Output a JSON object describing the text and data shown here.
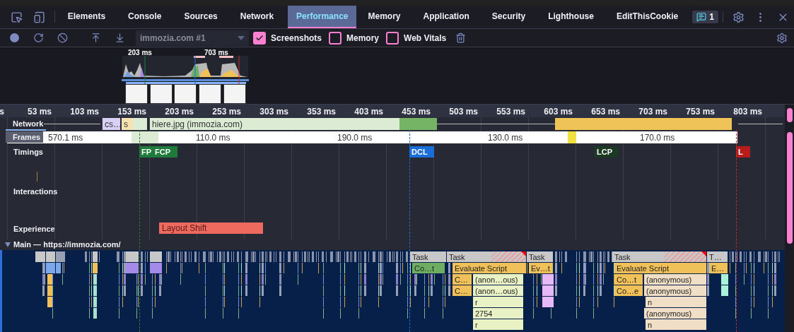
{
  "tabs": [
    {
      "label": "Elements",
      "selected": false
    },
    {
      "label": "Console",
      "selected": false
    },
    {
      "label": "Sources",
      "selected": false
    },
    {
      "label": "Network",
      "selected": false
    },
    {
      "label": "Performance",
      "selected": true
    },
    {
      "label": "Memory",
      "selected": false
    },
    {
      "label": "Application",
      "selected": false
    },
    {
      "label": "Security",
      "selected": false
    },
    {
      "label": "Lighthouse",
      "selected": false
    },
    {
      "label": "EditThisCookie",
      "selected": false
    }
  ],
  "issues_badge": "1",
  "toolbar": {
    "profile": "immozia.com #1",
    "options": [
      {
        "label": "Screenshots",
        "checked": true
      },
      {
        "label": "Memory",
        "checked": false
      },
      {
        "label": "Web Vitals",
        "checked": false
      }
    ]
  },
  "overview": {
    "markers": [
      "203 ms",
      "703 ms"
    ]
  },
  "ruler": [
    "s",
    "53 ms",
    "103 ms",
    "153 ms",
    "203 ms",
    "253 ms",
    "303 ms",
    "353 ms",
    "403 ms",
    "453 ms",
    "503 ms",
    "553 ms",
    "603 ms",
    "653 ms",
    "703 ms",
    "753 ms",
    "803 ms"
  ],
  "network": {
    "label": "Network",
    "requests": [
      "cs…",
      "s",
      "hiere.jpg (immozia.com)"
    ]
  },
  "frames": {
    "label": "Frames",
    "durations": [
      "570.1 ms",
      "110.0 ms",
      "190.0 ms",
      "130.0 ms",
      "170.0 ms"
    ]
  },
  "timings": {
    "label": "Timings",
    "marks": [
      {
        "label": "FP",
        "color": "#1e7b3a"
      },
      {
        "label": "FCP",
        "color": "#1e7b3a"
      },
      {
        "label": "DCL",
        "color": "#1a6ed8"
      },
      {
        "label": "LCP",
        "color": "#1b3a22"
      },
      {
        "label": "L",
        "color": "#b71c1c"
      }
    ]
  },
  "interactions": {
    "label": "Interactions"
  },
  "experience": {
    "label": "Experience",
    "events": [
      "Layout Shift"
    ]
  },
  "main": {
    "title": "Main — https://immozia.com/",
    "blocks": [
      {
        "text": "Task",
        "kind": "task",
        "long_task": false
      },
      {
        "text": "Task",
        "kind": "task",
        "long_task": true
      },
      {
        "text": "Task",
        "kind": "task",
        "long_task": false
      },
      {
        "text": "Task",
        "kind": "task",
        "long_task": true
      },
      {
        "text": "T…",
        "kind": "task",
        "long_task": false
      },
      {
        "text": "Co…t",
        "kind": "compile",
        "long_task": false
      },
      {
        "text": "Evaluate Script",
        "kind": "script",
        "long_task": false
      },
      {
        "text": "Ev…t",
        "kind": "script",
        "long_task": false
      },
      {
        "text": "Evaluate Script",
        "kind": "script",
        "long_task": false
      },
      {
        "text": "E…",
        "kind": "script",
        "long_task": false
      },
      {
        "text": "C…",
        "kind": "script",
        "long_task": false
      },
      {
        "text": "(anon…ous)",
        "kind": "function",
        "long_task": false
      },
      {
        "text": "Co…t",
        "kind": "script",
        "long_task": false
      },
      {
        "text": "(anonymous)",
        "kind": "call",
        "long_task": false
      },
      {
        "text": "C…",
        "kind": "script",
        "long_task": false
      },
      {
        "text": "(anon…ous)",
        "kind": "function",
        "long_task": false
      },
      {
        "text": "Co…e",
        "kind": "script",
        "long_task": false
      },
      {
        "text": "(anonymous)",
        "kind": "call",
        "long_task": false
      },
      {
        "text": "r",
        "kind": "function",
        "long_task": false
      },
      {
        "text": "n",
        "kind": "call",
        "long_task": false
      },
      {
        "text": "2754",
        "kind": "function",
        "long_task": false
      },
      {
        "text": "(anonymous)",
        "kind": "call",
        "long_task": false
      },
      {
        "text": "r",
        "kind": "function",
        "long_task": false
      },
      {
        "text": "n",
        "kind": "call",
        "long_task": false
      }
    ]
  }
}
